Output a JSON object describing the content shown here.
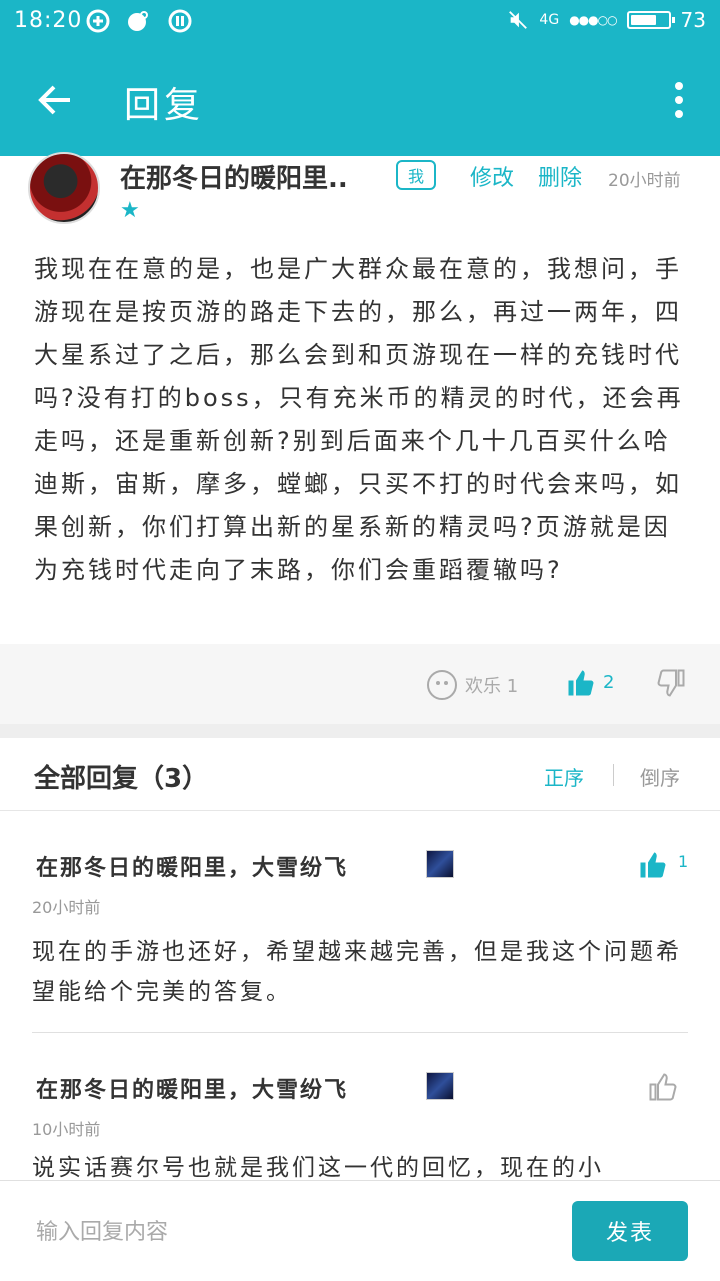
{
  "colors": {
    "accent": "#1bb6c7",
    "text": "#333333",
    "muted": "#999999",
    "send_button": "#1ba8b6"
  },
  "status_bar": {
    "time": "18:20",
    "signal_label": "4G",
    "battery_level": "73",
    "battery_fraction": 0.73
  },
  "app_bar": {
    "title": "回复",
    "back_icon": "arrow-left-icon",
    "more_icon": "more-vert-icon"
  },
  "post": {
    "author": "在那冬日的暖阳里..",
    "me_badge": "我",
    "edit_label": "修改",
    "delete_label": "删除",
    "time": "20小时前",
    "body": "我现在在意的是，也是广大群众最在意的，我想问，手游现在是按页游的路走下去的，那么，再过一两年，四大星系过了之后，那么会到和页游现在一样的充钱时代吗?没有打的boss，只有充米币的精灵的时代，还会再走吗，还是重新创新?别到后面来个几十几百买什么哈迪斯，宙斯，摩多，螳螂，只买不打的时代会来吗，如果创新，你们打算出新的星系新的精灵吗?页游就是因为充钱时代走向了末路，你们会重蹈覆辙吗?",
    "happy_label": "欢乐 1",
    "like_count": "2"
  },
  "replies_header": {
    "title": "全部回复（3）",
    "sort_asc": "正序",
    "sort_desc": "倒序"
  },
  "replies": [
    {
      "name": "在那冬日的暖阳里，大雪纷飞",
      "time": "20小时前",
      "text": "现在的手游也还好，希望越来越完善，但是我这个问题希望能给个完美的答复。",
      "like_count": "1",
      "liked": true
    },
    {
      "name": "在那冬日的暖阳里，大雪纷飞",
      "time": "10小时前",
      "text": "说实话赛尔号也就是我们这一代的回忆，现在的小",
      "like_count": "",
      "liked": false
    }
  ],
  "input_bar": {
    "placeholder": "输入回复内容",
    "send_label": "发表"
  }
}
